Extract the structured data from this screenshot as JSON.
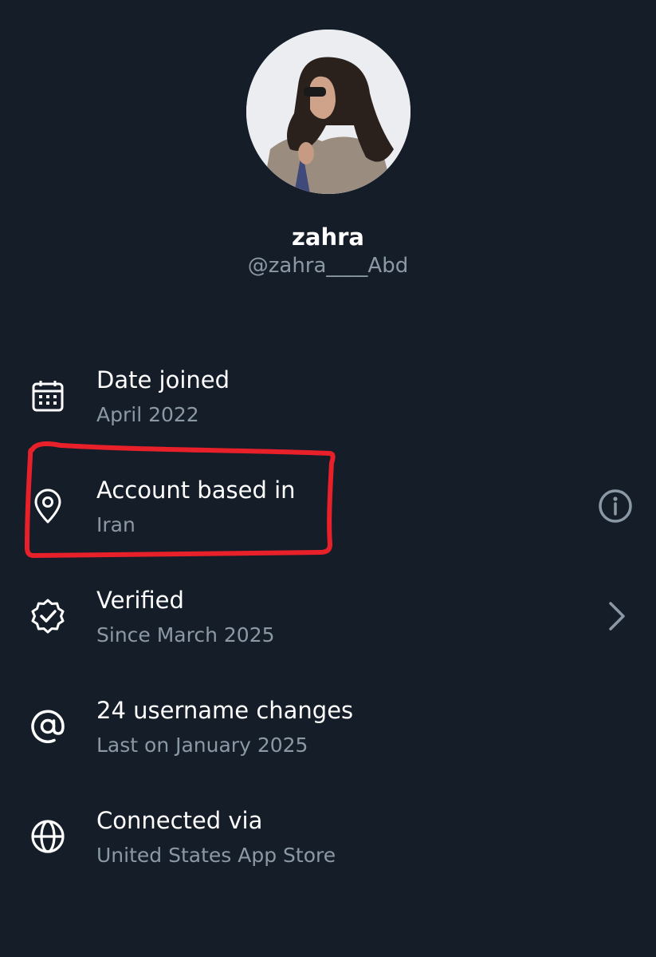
{
  "profile": {
    "display_name": "zahra",
    "handle": "@zahra____Abd"
  },
  "about_items": [
    {
      "icon": "calendar-icon",
      "title": "Date joined",
      "subtitle": "April 2022",
      "trailing": ""
    },
    {
      "icon": "location-pin-icon",
      "title": "Account based in",
      "subtitle": "Iran",
      "trailing": "info-icon"
    },
    {
      "icon": "verified-badge-icon",
      "title": "Verified",
      "subtitle": "Since March 2025",
      "trailing": "chevron-right-icon"
    },
    {
      "icon": "at-sign-icon",
      "title": "24 username changes",
      "subtitle": "Last on January 2025",
      "trailing": ""
    },
    {
      "icon": "globe-icon",
      "title": "Connected via",
      "subtitle": "United States App Store",
      "trailing": ""
    }
  ],
  "annotation": {
    "type": "hand-drawn red box around 'Account based in'",
    "color": "#e8202a"
  },
  "colors": {
    "background": "#151d29",
    "primary_text": "#ffffff",
    "secondary_text": "#8b98a5"
  }
}
